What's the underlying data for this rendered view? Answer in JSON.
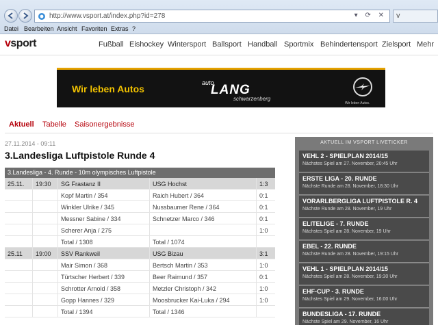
{
  "browser": {
    "url": "http://www.vsport.at/index.php?id=278",
    "tab_label": "v",
    "addr_controls": "▾ ⟳ ✕",
    "menu": [
      "Datei",
      "Bearbeiten",
      "Ansicht",
      "Favoriten",
      "Extras",
      "?"
    ]
  },
  "site": {
    "logo_v": "v",
    "logo_rest": "sport",
    "nav": [
      "Fußball",
      "Eishockey",
      "Wintersport",
      "Ballsport",
      "Handball",
      "Sportmix",
      "Behindertensport",
      "Zielsport",
      "Mehr"
    ]
  },
  "banner": {
    "slogan": "Wir leben Autos",
    "brand_prefix": "auto",
    "brand_name": "LANG",
    "brand_city": "schwarzenberg",
    "opel_tagline": "Wir leben Autos."
  },
  "subnav": [
    "Aktuell",
    "Tabelle",
    "Saisonergebnisse"
  ],
  "article": {
    "date": "27.11.2014 - 09:11",
    "headline": "3.Landesliga Luftpistole Runde 4",
    "table_caption": "3.Landesliga - 4. Runde - 10m olympisches Luftpistole",
    "rows": [
      {
        "type": "match",
        "date": "25.11.",
        "time": "19:30",
        "home": "SG Frastanz II",
        "away": "USG Hochst",
        "score": "1:3"
      },
      {
        "type": "shooter",
        "date": "",
        "time": "",
        "home": "Kopf Martin / 354",
        "away": "Raich Hubert / 364",
        "score": "0:1"
      },
      {
        "type": "shooter",
        "date": "",
        "time": "",
        "home": "Winkler Ulrike / 345",
        "away": "Nussbaumer Rene / 364",
        "score": "0:1"
      },
      {
        "type": "shooter",
        "date": "",
        "time": "",
        "home": "Messner Sabine / 334",
        "away": "Schnetzer Marco / 346",
        "score": "0:1"
      },
      {
        "type": "shooter",
        "date": "",
        "time": "",
        "home": "Scherer Anja / 275",
        "away": "",
        "score": "1:0"
      },
      {
        "type": "total",
        "date": "",
        "time": "",
        "home": "Total / 1308",
        "away": "Total / 1074",
        "score": ""
      },
      {
        "type": "match",
        "date": "25.11",
        "time": "19:00",
        "home": "SSV Rankweil",
        "away": "USG Bizau",
        "score": "3:1"
      },
      {
        "type": "shooter",
        "date": "",
        "time": "",
        "home": "Mair Simon / 368",
        "away": "Bertsch Martin / 353",
        "score": "1:0"
      },
      {
        "type": "shooter",
        "date": "",
        "time": "",
        "home": "Türtscher Herbert / 339",
        "away": "Beer Raimund / 357",
        "score": "0:1"
      },
      {
        "type": "shooter",
        "date": "",
        "time": "",
        "home": "Schrotter Arnold / 358",
        "away": "Metzler Christoph / 342",
        "score": "1:0"
      },
      {
        "type": "shooter",
        "date": "",
        "time": "",
        "home": "Gopp Hannes / 329",
        "away": "Moosbrucker Kai-Luka / 294",
        "score": "1:0"
      },
      {
        "type": "total",
        "date": "",
        "time": "",
        "home": "Total / 1394",
        "away": "Total / 1346",
        "score": ""
      }
    ]
  },
  "sidebar": {
    "title": "AKTUELL IM VSPORT LIVETICKER",
    "items": [
      {
        "title": "VEHL 2 - SPIELPLAN 2014/15",
        "sub": "Nächstes Spiel am 27. November, 20:45 Uhr"
      },
      {
        "title": "ERSTE LIGA - 20. RUNDE",
        "sub": "Nächste Runde am 28. November, 18:30 Uhr"
      },
      {
        "title": "VORARLBERGLIGA LUFTPISTOLE R. 4",
        "sub": "Nächste Runde am 28. November, 19 Uhr"
      },
      {
        "title": "ELITELIGE - 7. RUNDE",
        "sub": "Nächstes Spiel am 28. November, 19 Uhr"
      },
      {
        "title": "EBEL - 22. RUNDE",
        "sub": "Nächste Runde am 28. November, 19:15 Uhr"
      },
      {
        "title": "VEHL 1 - SPIELPLAN 2014/15",
        "sub": "Nächstes Spiel am 28. November, 19:30 Uhr"
      },
      {
        "title": "EHF-CUP - 3. RUNDE",
        "sub": "Nächstes Spiel am 29. November, 16:00 Uhr"
      },
      {
        "title": "BUNDESLIGA - 17. RUNDE",
        "sub": "Nächste Spiel am 29. November, 16 Uhr"
      }
    ]
  }
}
